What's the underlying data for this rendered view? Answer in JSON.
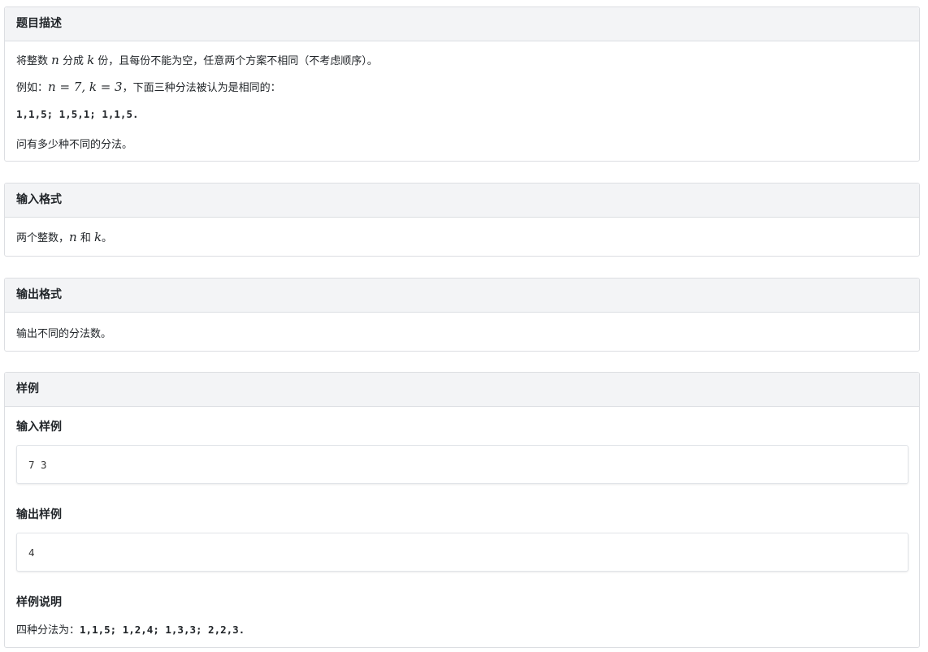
{
  "description": {
    "title": "题目描述",
    "l1_a": "将整数 ",
    "l1_n": "n",
    "l1_b": " 分成 ",
    "l1_k": "k",
    "l1_c": " 份，且每份不能为空，任意两个方案不相同（不考虑顺序）。",
    "l2_a": "例如：",
    "l2_math": "n = 7, k = 3",
    "l2_b": "，下面三种分法被认为是相同的：",
    "l3": "1,1,5; 1,5,1; 1,1,5.",
    "l4": "问有多少种不同的分法。"
  },
  "input_format": {
    "title": "输入格式",
    "a": "两个整数，",
    "n": "n",
    "b": " 和 ",
    "k": "k",
    "c": "。"
  },
  "output_format": {
    "title": "输出格式",
    "text": "输出不同的分法数。"
  },
  "sample": {
    "title": "样例",
    "input_title": "输入样例",
    "input_value": "7 3",
    "output_title": "输出样例",
    "output_value": "4",
    "explain_title": "样例说明",
    "explain_a": "四种分法为：",
    "explain_b": "1,1,5; 1,2,4; 1,3,3; 2,2,3."
  }
}
